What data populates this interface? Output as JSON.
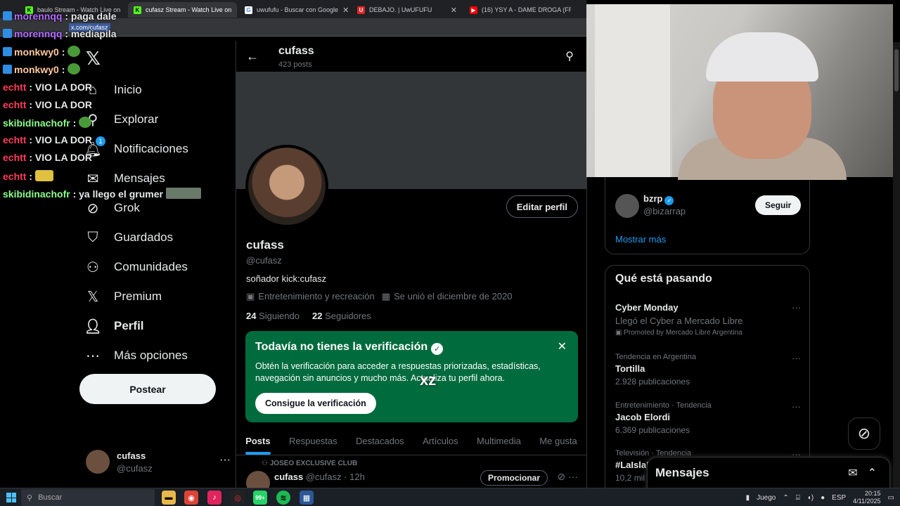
{
  "browser": {
    "tabs": [
      {
        "title": "baulo Stream - Watch Live on",
        "favicon": "kick-icon",
        "color": "#53fc18"
      },
      {
        "title": "cufasz Stream - Watch Live on",
        "favicon": "kick-icon",
        "color": "#53fc18"
      },
      {
        "title": "uwufufu - Buscar con Google",
        "favicon": "google-icon",
        "color": "#ffffff"
      },
      {
        "title": "DEBAJO. | UwUFUFU",
        "favicon": "uwufufu-icon",
        "color": "#e02424"
      },
      {
        "title": "(16) YSY A - DAME DROGA (FR",
        "favicon": "youtube-icon",
        "color": "#ff0000"
      }
    ],
    "url": "x.com/cufasz"
  },
  "chat": [
    {
      "user": "morennqq",
      "text": ": paga dale",
      "color": "#b36cff"
    },
    {
      "user": "morennqq",
      "text": ": mediapila",
      "color": "#b36cff"
    },
    {
      "user": "monkwy0",
      "text": ":",
      "color": "#ffc8a0"
    },
    {
      "user": "monkwy0",
      "text": ":",
      "color": "#ffc8a0"
    },
    {
      "user": "echtt",
      "text": ": VIO LA DOR",
      "color": "#ff3c5a"
    },
    {
      "user": "echtt",
      "text": ": VIO LA DOR",
      "color": "#ff3c5a"
    },
    {
      "user": "skibidinachofr",
      "text": ":",
      "color": "#8cff8c"
    },
    {
      "user": "echtt",
      "text": ": VIO LA DOR",
      "color": "#ff3c5a"
    },
    {
      "user": "echtt",
      "text": ": VIO LA DOR",
      "color": "#ff3c5a"
    },
    {
      "user": "echtt",
      "text": ":",
      "color": "#ff3c5a"
    },
    {
      "user": "skibidinachofr",
      "text": ": ya llego el grumer",
      "color": "#8cff8c"
    }
  ],
  "nav": {
    "items": [
      {
        "label": "Inicio",
        "icon": "home-icon"
      },
      {
        "label": "Explorar",
        "icon": "search-icon"
      },
      {
        "label": "Notificaciones",
        "icon": "bell-icon",
        "badge": "1"
      },
      {
        "label": "Mensajes",
        "icon": "mail-icon"
      },
      {
        "label": "Grok",
        "icon": "grok-icon"
      },
      {
        "label": "Guardados",
        "icon": "bookmark-icon"
      },
      {
        "label": "Comunidades",
        "icon": "communities-icon"
      },
      {
        "label": "Premium",
        "icon": "x-icon"
      },
      {
        "label": "Perfil",
        "icon": "person-icon"
      },
      {
        "label": "Más opciones",
        "icon": "more-icon"
      }
    ],
    "post_button": "Postear",
    "account": {
      "name": "cufass",
      "handle": "@cufasz"
    }
  },
  "profile": {
    "header_name": "cufass",
    "header_posts": "423 posts",
    "edit_button": "Editar perfil",
    "name": "cufass",
    "handle": "@cufasz",
    "bio": "soñador  kick:cufasz",
    "category": "Entretenimiento y recreación",
    "joined": "Se unió el diciembre de 2020",
    "following_count": "24",
    "following_label": "Siguiendo",
    "followers_count": "22",
    "followers_label": "Seguidores"
  },
  "verification": {
    "title": "Todavía no tienes la verificación",
    "text": "Obtén la verificación para acceder a respuestas priorizadas, estadísticas, navegación sin anuncios y mucho más. Actualiza tu perfil ahora.",
    "button": "Consigue la verificación"
  },
  "overlay_text": "xz",
  "profile_tabs": [
    "Posts",
    "Respuestas",
    "Destacados",
    "Artículos",
    "Multimedia",
    "Me gusta"
  ],
  "post": {
    "pinned_label": "JOSEO EXCLUSIVE CLUB",
    "author": "cufass",
    "handle_time": "@cufasz · 12h",
    "promote_button": "Promocionar"
  },
  "sidebar": {
    "suggestion": {
      "name": "bzrp",
      "handle": "@bizarrap",
      "follow_button": "Seguir"
    },
    "show_more": "Mostrar más",
    "trends_title": "Qué está pasando",
    "trends": [
      {
        "context": "",
        "title": "Cyber Monday",
        "subtitle": "Llegó el Cyber a Mercado Libre",
        "meta": "Promoted by Mercado Libre Argentina"
      },
      {
        "context": "Tendencia en Argentina",
        "title": "Tortilla",
        "subtitle": "2.928 publicaciones"
      },
      {
        "context": "Entretenimiento · Tendencia",
        "title": "Jacob Elordi",
        "subtitle": "6.369 publicaciones"
      },
      {
        "context": "Televisión · Tendencia",
        "title": "#LaIslaD",
        "subtitle": "10,2 mil p"
      }
    ],
    "messages_title": "Mensajes"
  },
  "taskbar": {
    "search_placeholder": "Buscar",
    "badge": "99+",
    "game_label": "Juego",
    "lang": "ESP",
    "time": "20:15",
    "date": "4/11/2025"
  },
  "colors": {
    "accent": "#1d9bf0",
    "verify_bg": "#006b3d",
    "bg": "#000000"
  }
}
